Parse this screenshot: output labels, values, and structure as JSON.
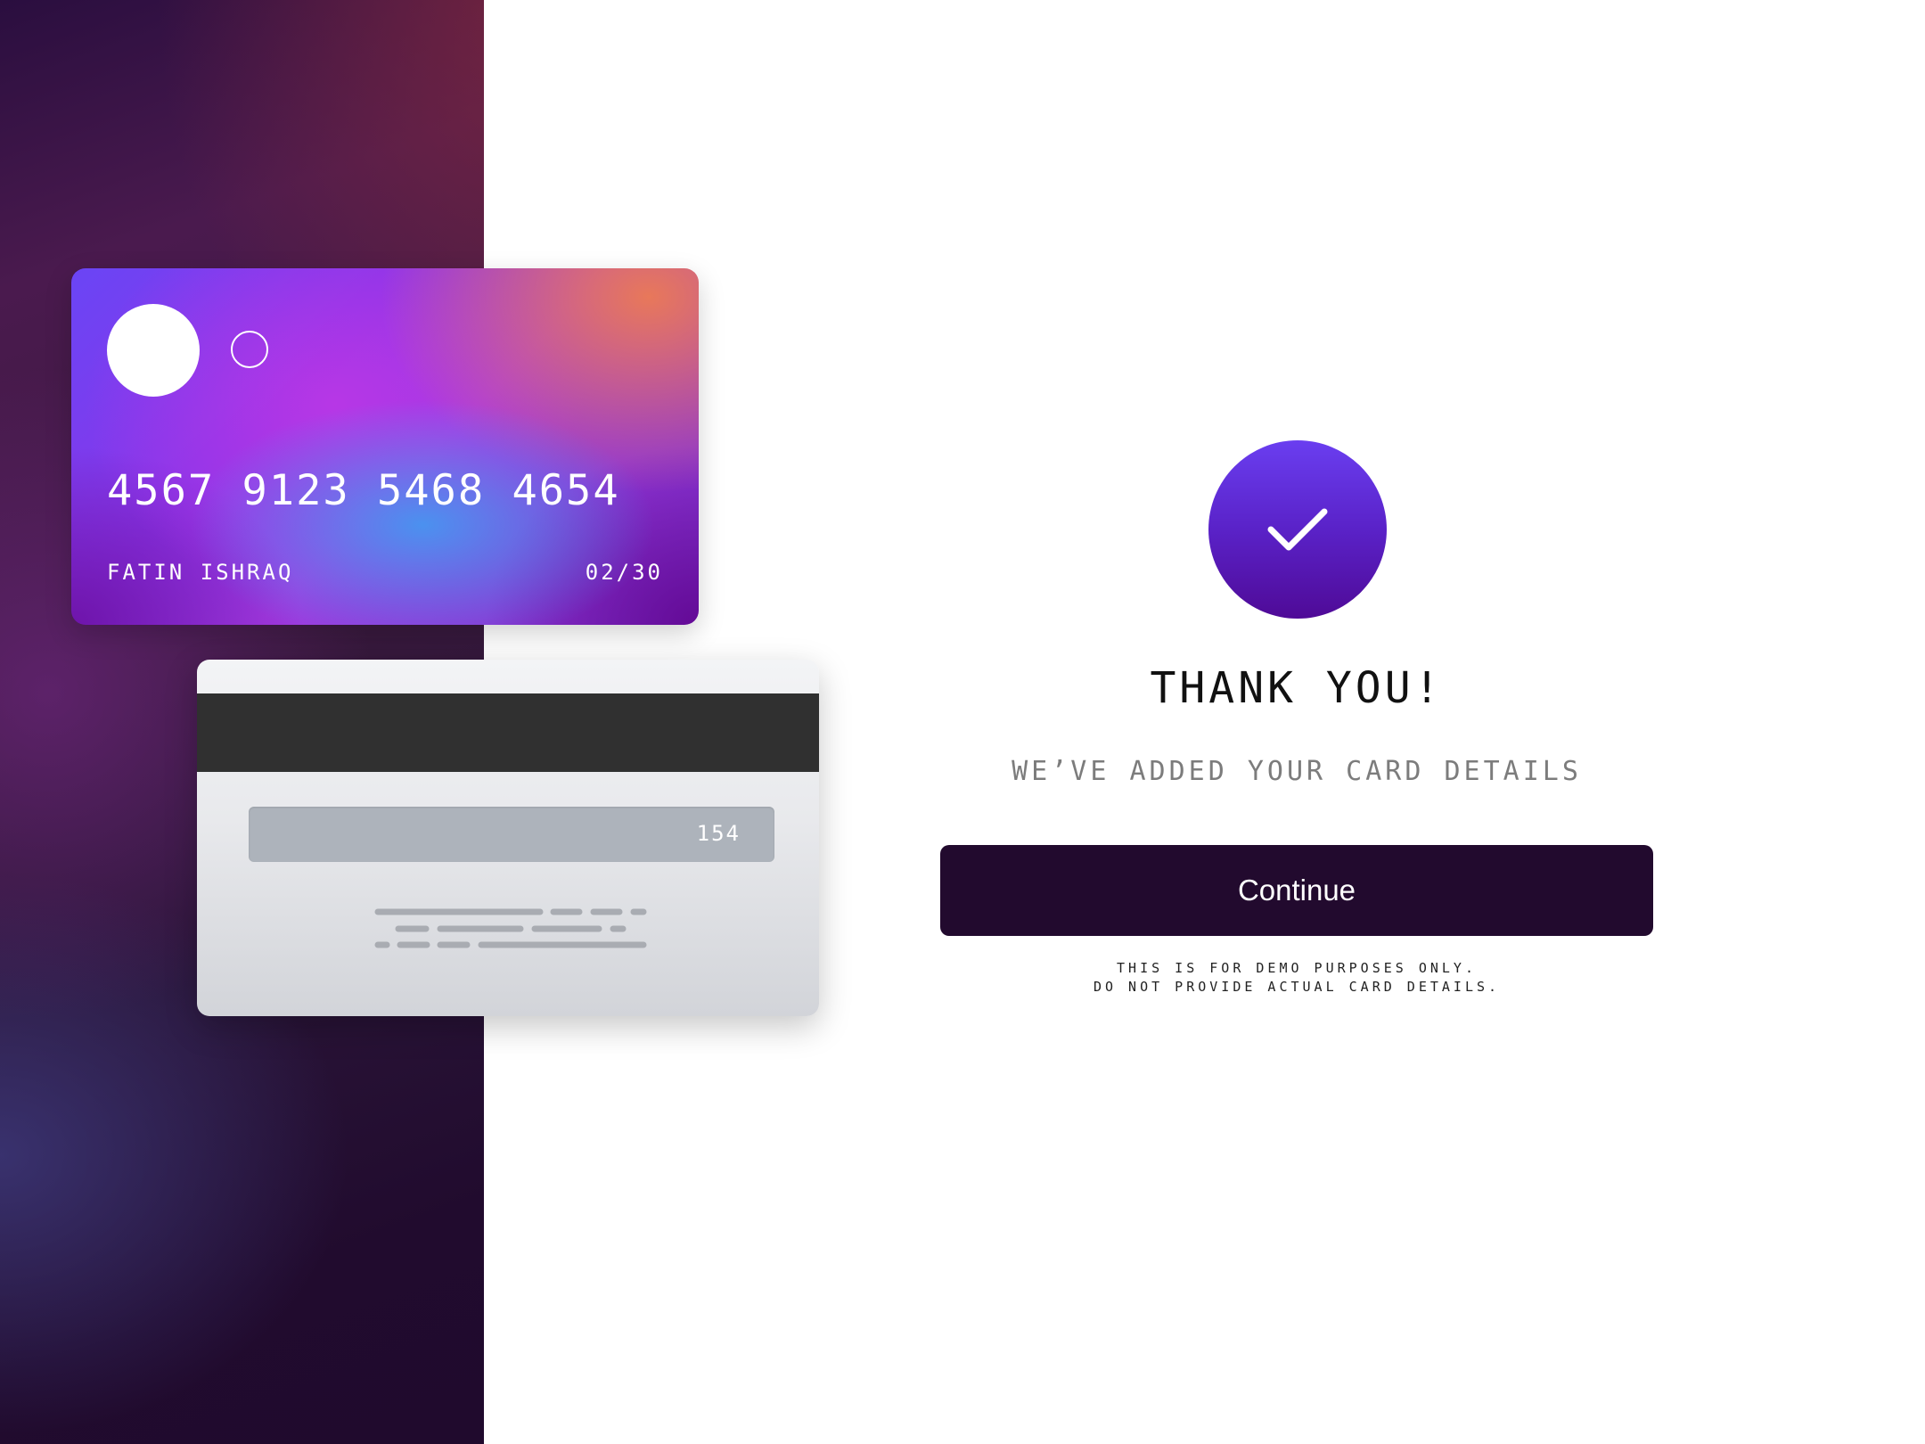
{
  "card_front": {
    "number": "4567 9123 5468 4654",
    "holder": "FATIN ISHRAQ",
    "expiry": "02/30"
  },
  "card_back": {
    "cvv": "154"
  },
  "confirmation": {
    "icon": "checkmark-icon",
    "title": "THANK YOU!",
    "subtitle": "WE’VE ADDED YOUR CARD DETAILS",
    "button_label": "Continue",
    "disclaimer_line1": "THIS IS FOR DEMO PURPOSES ONLY.",
    "disclaimer_line2": "DO NOT PROVIDE ACTUAL CARD DETAILS."
  },
  "colors": {
    "panel_dark": "#210b2e",
    "button_bg": "#220a2e",
    "accent_purple": "#5a22c8",
    "subtitle_gray": "#7c7c7c"
  }
}
